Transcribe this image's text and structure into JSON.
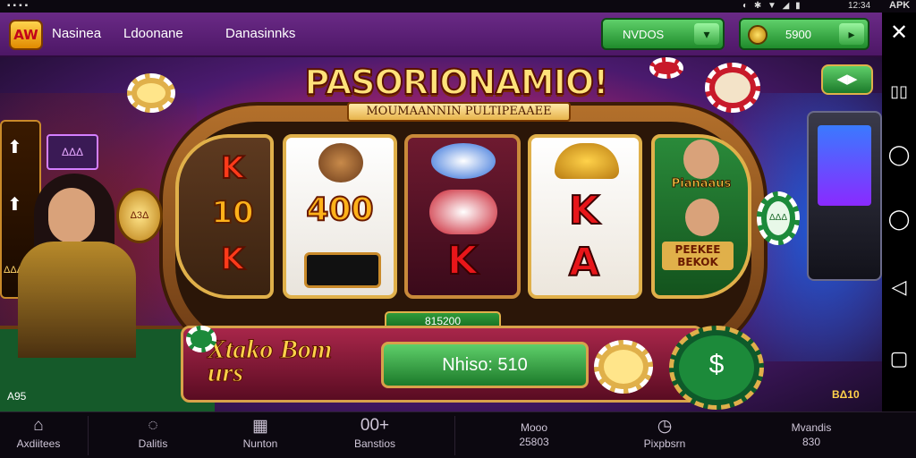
{
  "status_bar": {
    "left_icons": "▪▪▪▪",
    "right_icons": "◐ ✱ ▼ ◢ ▮",
    "time": "12:34",
    "apk": "APK"
  },
  "top_nav": {
    "logo_text": "AW",
    "items": [
      "Nasinea",
      "Ldoonane",
      "Danasinnks"
    ],
    "pill_left": {
      "label": "NVDOS",
      "icon": "chevron-right-icon"
    },
    "pill_right": {
      "label": "5900",
      "icon": "chevron-right-icon"
    }
  },
  "game": {
    "title": "PASORIONAMIO!",
    "subtitle": "MOUMAANNIN PULTIPEAAEE",
    "reel_0": [
      "K",
      "10",
      "K"
    ],
    "reel_1_value": "400",
    "reel_2_letter": "K",
    "reel_3_letters": [
      "K",
      "A"
    ],
    "reel_4_labels": [
      "Pianaaus",
      "PEEKEE BEKOK"
    ],
    "coin_left_label": "Δ3Δ",
    "chip_right_label": "ΔΔΔ",
    "bet_strip": "815200",
    "panel_title": "Xtako Bom urs",
    "win_display": "Nhiso: 510",
    "side_left_label": "ΔΔΔ",
    "sign_label": "ΔΔΔ",
    "table_left_label": "A95",
    "right_bottom_label": "BΔ10",
    "right_top_button": "◀▶"
  },
  "bottom_nav": {
    "items": [
      {
        "label": "Axdiitees",
        "icon": "home-icon"
      },
      {
        "label": "Dalitis",
        "icon": "gift-icon"
      },
      {
        "label": "Nunton",
        "icon": "grid-icon"
      },
      {
        "label": "Banstios",
        "icon": "game-icon",
        "icon_text": "00+"
      },
      {
        "label": "Mooo",
        "value": "25803",
        "icon": "none"
      },
      {
        "label": "Pixpbsrn",
        "icon": "clock-icon"
      },
      {
        "label": "Mvandis",
        "value": "830",
        "icon": "none"
      }
    ]
  },
  "android_nav": {
    "close": "✕",
    "icons": [
      "▯▯",
      "◯",
      "◯",
      "◁",
      "▢",
      "⤡"
    ]
  }
}
